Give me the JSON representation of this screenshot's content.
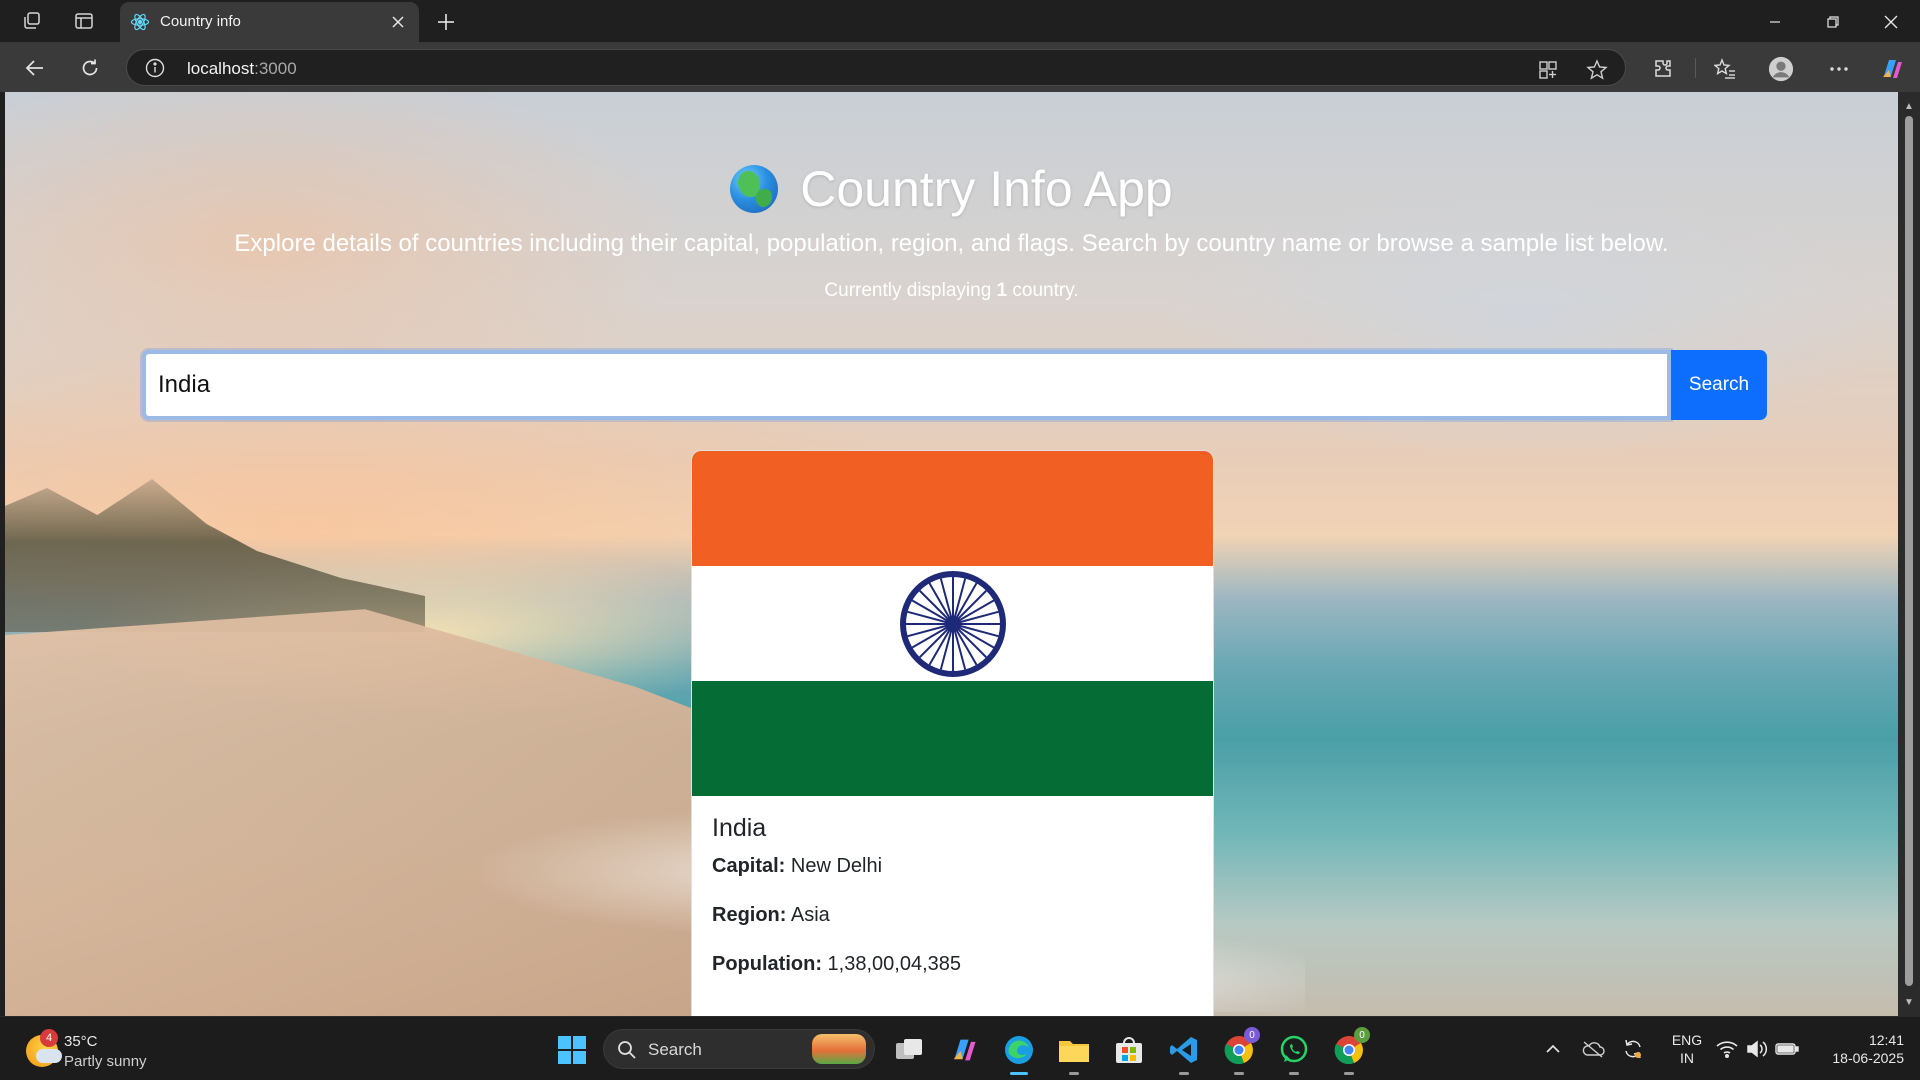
{
  "browser": {
    "tab_title": "Country info",
    "url_host": "localhost",
    "url_port": ":3000"
  },
  "page": {
    "title": "Country Info App",
    "subtitle": "Explore details of countries including their capital, population, region, and flags. Search by country name or browse a sample list below.",
    "count_prefix": "Currently displaying ",
    "count_value": "1",
    "count_suffix": " country.",
    "search": {
      "value": "India",
      "button_label": "Search"
    },
    "card": {
      "name": "India",
      "capital_label": "Capital:",
      "capital_value": " New Delhi",
      "region_label": "Region:",
      "region_value": " Asia",
      "population_label": "Population:",
      "population_value": " 1,38,00,04,385",
      "flag_colors": {
        "saffron": "#f15f22",
        "white": "#ffffff",
        "green": "#056c36",
        "chakra": "#1e2a78"
      }
    }
  },
  "taskbar": {
    "weather_badge": "4",
    "weather_temp": "35°C",
    "weather_condition": "Partly sunny",
    "search_label": "Search",
    "chrome_badge_1": "0",
    "chrome_badge_2": "0",
    "lang_line1": "ENG",
    "lang_line2": "IN",
    "time": "12:41",
    "date": "18-06-2025"
  },
  "colors": {
    "accent": "#0d6efd",
    "chrome_bg": "#3a3a3a"
  }
}
